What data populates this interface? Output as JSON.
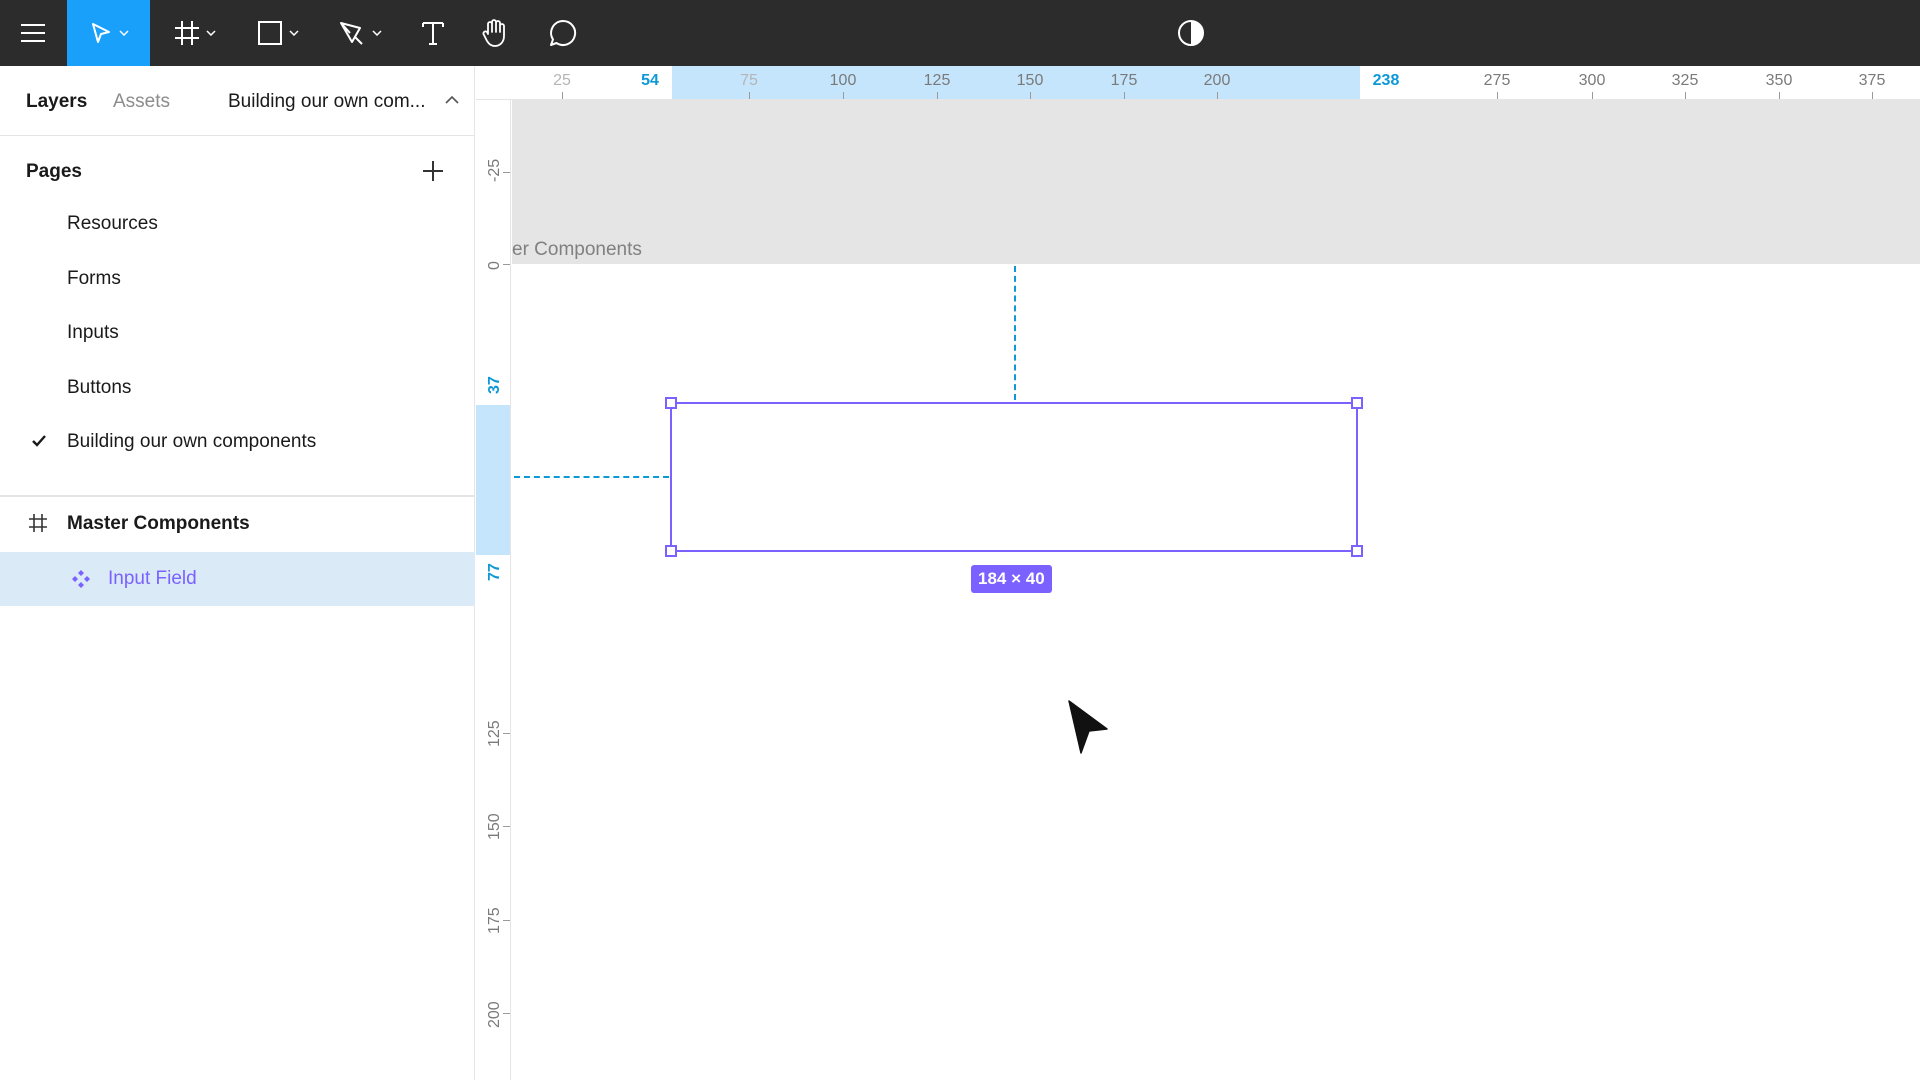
{
  "toolbar": {
    "tools": [
      {
        "name": "main-menu",
        "icon": "hamburger-menu-icon"
      },
      {
        "name": "move-tool",
        "icon": "cursor-arrow-icon",
        "active": true
      },
      {
        "name": "frame-tool",
        "icon": "frame-hash-icon"
      },
      {
        "name": "shape-tool",
        "icon": "rectangle-icon"
      },
      {
        "name": "pen-tool",
        "icon": "pen-icon"
      },
      {
        "name": "text-tool",
        "icon": "text-T-icon"
      },
      {
        "name": "hand-tool",
        "icon": "hand-icon"
      },
      {
        "name": "comment-tool",
        "icon": "comment-bubble-icon"
      },
      {
        "name": "theme-toggle",
        "icon": "contrast-half-circle-icon"
      }
    ],
    "accent_color": "#18a0fb",
    "background_color": "#2c2c2c"
  },
  "left_panel": {
    "tabs": {
      "layers": "Layers",
      "assets": "Assets"
    },
    "current_page": "Building our own com...",
    "pages_header": "Pages",
    "pages": [
      {
        "label": "Resources",
        "selected": false
      },
      {
        "label": "Forms",
        "selected": false
      },
      {
        "label": "Inputs",
        "selected": false
      },
      {
        "label": "Buttons",
        "selected": false
      },
      {
        "label": "Building our own components",
        "selected": true
      }
    ],
    "layers": [
      {
        "label": "Master Components",
        "icon": "frame-hash-icon",
        "selected": false
      },
      {
        "label": "Input Field",
        "icon": "component-diamond-icon",
        "selected": true
      }
    ]
  },
  "rulers": {
    "top": {
      "labels": [
        "25",
        "54",
        "75",
        "100",
        "125",
        "150",
        "175",
        "200",
        "238",
        "275",
        "300",
        "325",
        "350",
        "375"
      ],
      "selection_start": "54",
      "selection_end": "238"
    },
    "left": {
      "labels": [
        "-25",
        "0",
        "37",
        "77",
        "125",
        "150",
        "175",
        "200"
      ],
      "selection_start": "37",
      "selection_end": "77"
    },
    "highlight_color": "#c4e5fb",
    "accent_color": "#0d99d6"
  },
  "canvas": {
    "frame_label": "er Components",
    "selection_size": "184 × 40",
    "selection_color": "#7b61ff"
  }
}
